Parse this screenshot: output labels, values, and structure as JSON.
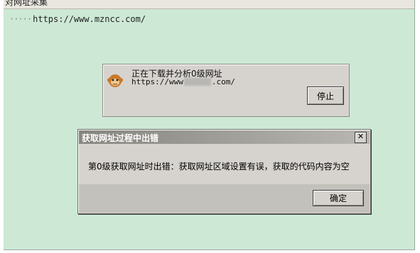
{
  "app_window": {
    "title": "对网址采集",
    "tree_url": "https://www.mzncc.com/"
  },
  "progress_dialog": {
    "status_text": "正在下载并分析0级网址",
    "url_prefix": "https://www",
    "url_suffix": ".com/",
    "stop_label": "停止",
    "icon": "monkey-icon"
  },
  "error_dialog": {
    "title": "获取网址过程中出错",
    "close_label": "✕",
    "message": "第0级获取网址时出错：获取网址区域设置有误，获取的代码内容为空",
    "ok_label": "确定"
  }
}
